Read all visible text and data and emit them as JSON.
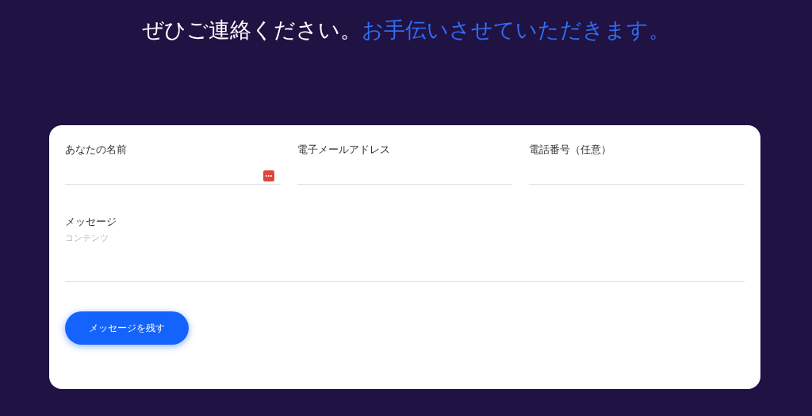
{
  "headline": [
    {
      "text": "ぜひご連絡ください。",
      "kind": "plain"
    },
    {
      "text": "お手伝いさせていただきます。",
      "kind": "accent"
    }
  ],
  "form": {
    "fields": [
      {
        "label": "あなたの名前",
        "autofill": true
      },
      {
        "label": "電子メールアドレス",
        "autofill": false
      },
      {
        "label": "電話番号（任意）",
        "autofill": false
      }
    ],
    "message": {
      "label": "メッセージ",
      "placeholder": "コンテンツ"
    },
    "submit": "メッセージを残す"
  }
}
